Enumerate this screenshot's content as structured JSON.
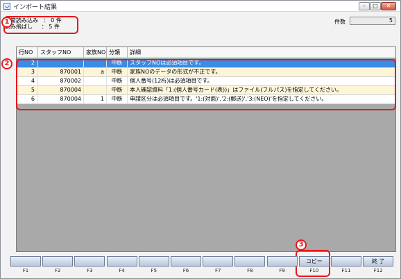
{
  "window": {
    "title": "インポート結果"
  },
  "summary": {
    "normal_label": "正常読み込み",
    "normal_value": "0 件",
    "skip_label": "読み飛ばし",
    "skip_value": "5 件"
  },
  "count": {
    "label": "件数",
    "value": "5"
  },
  "grid": {
    "headers": [
      "行NO",
      "スタッフNO",
      "家族NO",
      "分類",
      "詳細"
    ],
    "rows": [
      {
        "row_no": "2",
        "staff_no": "",
        "family_no": "",
        "category": "中断",
        "detail": "スタッフNOは必須項目です。",
        "state": "selected"
      },
      {
        "row_no": "3",
        "staff_no": "870001",
        "family_no": "a",
        "category": "中断",
        "detail": "家族NOのデータの形式が不正です。",
        "state": "alt"
      },
      {
        "row_no": "4",
        "staff_no": "870002",
        "family_no": "",
        "category": "中断",
        "detail": "個人番号(12桁)は必須項目です。",
        "state": "normal"
      },
      {
        "row_no": "5",
        "staff_no": "870004",
        "family_no": "",
        "category": "中断",
        "detail": "本人確認資料「1:(個人番号カード(表))」はファイル(フルパス)を指定してください。",
        "state": "alt"
      },
      {
        "row_no": "6",
        "staff_no": "870004",
        "family_no": "1",
        "category": "中断",
        "detail": "申請区分は必須項目です。'1:(対面)','2:(郵送)','3:(NEO)'を指定してください。",
        "state": "normal"
      }
    ]
  },
  "callouts": [
    "1",
    "2",
    "3"
  ],
  "function_keys": [
    {
      "key": "F1",
      "label": ""
    },
    {
      "key": "F2",
      "label": ""
    },
    {
      "key": "F3",
      "label": ""
    },
    {
      "key": "F4",
      "label": ""
    },
    {
      "key": "F5",
      "label": ""
    },
    {
      "key": "F6",
      "label": ""
    },
    {
      "key": "F7",
      "label": ""
    },
    {
      "key": "F8",
      "label": ""
    },
    {
      "key": "F9",
      "label": ""
    },
    {
      "key": "F10",
      "label": "コピー"
    },
    {
      "key": "F11",
      "label": ""
    },
    {
      "key": "F12",
      "label": "終 了"
    }
  ],
  "colors": {
    "highlight": "#e8161b",
    "selected_row": "#3a8ce4",
    "alt_row": "#fdf5d8",
    "grid_background": "#a9a9a9"
  },
  "icons": {
    "app": "import-window-icon",
    "minimize": "minimize-icon",
    "maximize": "maximize-icon",
    "close": "close-icon"
  }
}
